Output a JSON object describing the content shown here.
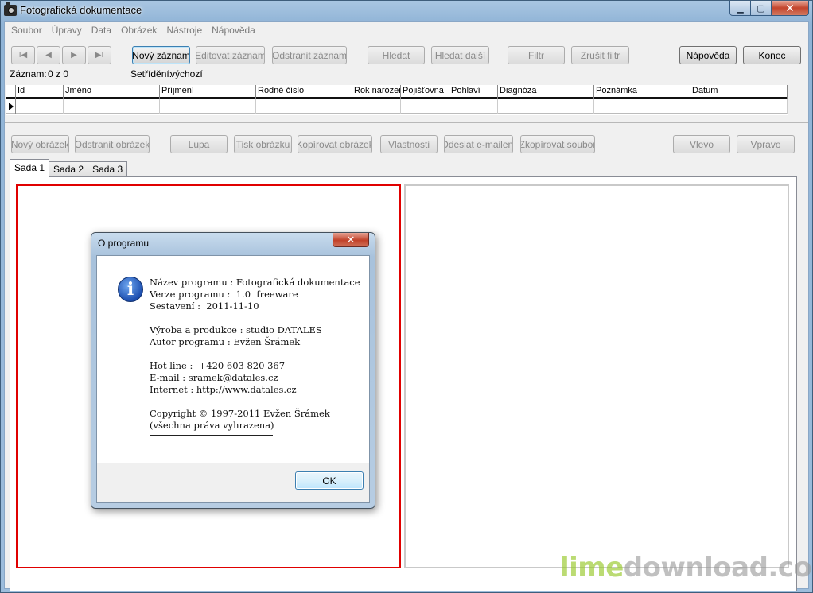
{
  "window": {
    "title": "Fotografická dokumentace",
    "min_glyph": "▁",
    "max_glyph": "▢",
    "close_glyph": "✕"
  },
  "menu": [
    "Soubor",
    "Úpravy",
    "Data",
    "Obrázek",
    "Nástroje",
    "Nápověda"
  ],
  "nav": {
    "first": "I◀",
    "prev": "◀",
    "next": "▶",
    "last": "▶I"
  },
  "toolbar": {
    "new_record": "Nový záznam",
    "edit_record": "Editovat záznam",
    "remove_record": "Odstranit záznam",
    "find": "Hledat",
    "find_next": "Hledat další",
    "filter": "Filtr",
    "cancel_filter": "Zrušit filtr",
    "help": "Nápověda",
    "exit": "Konec"
  },
  "status": {
    "record_label": "Záznam:",
    "record_value": "0 z 0",
    "sort_label": "Setřídění:",
    "sort_value": "výchozí"
  },
  "grid": {
    "columns": [
      "Id",
      "Jméno",
      "Příjmení",
      "Rodné číslo",
      "Rok narozen",
      "Pojišťovna",
      "Pohlaví",
      "Diagnóza",
      "Poznámka",
      "Datum"
    ]
  },
  "image_toolbar": {
    "new_image": "Nový obrázek",
    "remove_image": "Odstranit obrázek",
    "magnifier": "Lupa",
    "print_image": "Tisk obrázku",
    "copy_image": "Kopírovat obrázek",
    "properties": "Vlastnosti",
    "send_email": "Odeslat e-mailem",
    "copy_file": "Zkopírovat soubor",
    "left": "Vlevo",
    "right": "Vpravo"
  },
  "tabs": [
    "Sada 1",
    "Sada 2",
    "Sada 3"
  ],
  "dialog": {
    "title": "O programu",
    "close_glyph": "✕",
    "icon_glyph": "i",
    "lines": {
      "name": "Název programu : Fotografická dokumentace",
      "version": "Verze programu :  1.0  freeware",
      "build": "Sestavení :  2011-11-10",
      "producer": "Výroba a produkce : studio DATALES",
      "author": "Autor programu : Evžen Šrámek",
      "hotline": "Hot line :  +420 603 820 367",
      "email": "E-mail : sramek@datales.cz",
      "internet": "Internet : http://www.datales.cz",
      "copyright": "Copyright © 1997-2011 Evžen Šrámek",
      "rights": "(všechna práva vyhrazena)"
    },
    "ok": "OK"
  },
  "watermark": {
    "part1": "lime",
    "part2": "download.com"
  }
}
